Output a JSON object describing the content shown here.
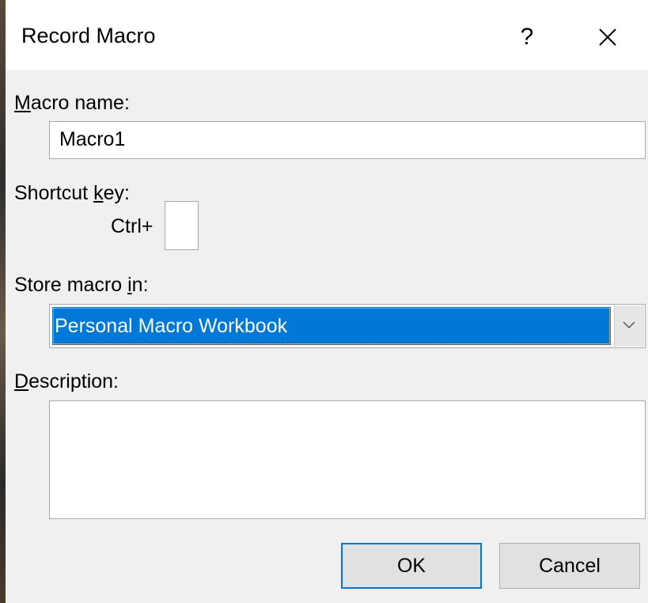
{
  "dialog": {
    "title": "Record Macro",
    "help_label": "?",
    "close_icon": "close-icon"
  },
  "macro_name": {
    "label_mnemonic": "M",
    "label_rest": "acro name:",
    "value": "Macro1"
  },
  "shortcut": {
    "label_before": "Shortcut ",
    "label_mnemonic": "k",
    "label_after": "ey:",
    "ctrl_label": "Ctrl+",
    "value": ""
  },
  "store": {
    "label_before": "Store macro ",
    "label_mnemonic": "i",
    "label_after": "n:",
    "selected": "Personal Macro Workbook",
    "dropdown_icon": "chevron-down-icon"
  },
  "description": {
    "label_mnemonic": "D",
    "label_rest": "escription:",
    "value": ""
  },
  "buttons": {
    "ok": "OK",
    "cancel": "Cancel"
  },
  "colors": {
    "selection": "#0078d7",
    "dialog_bg": "#f0f0f0",
    "titlebar_bg": "#ffffff"
  }
}
